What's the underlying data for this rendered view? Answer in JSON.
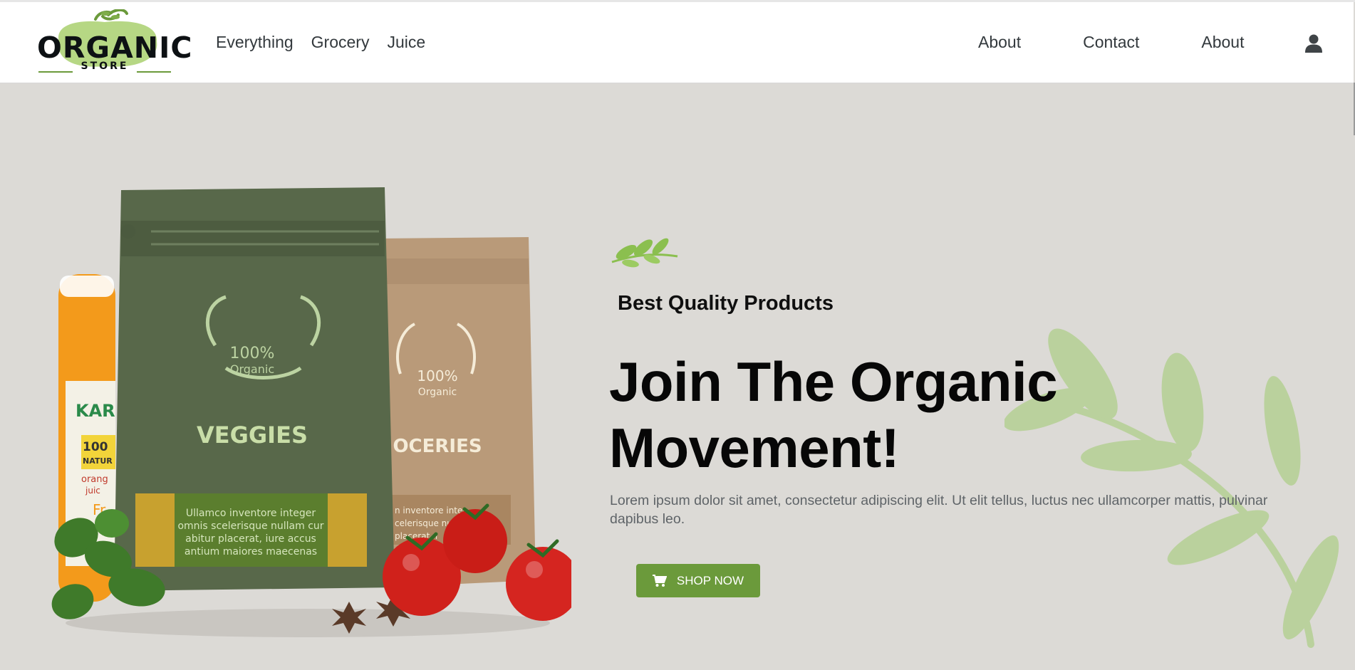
{
  "logo": {
    "word": "ORGANIC",
    "sub": "STORE"
  },
  "nav": {
    "left": [
      "Everything",
      "Grocery",
      "Juice"
    ],
    "right": [
      "About",
      "Contact",
      "About"
    ]
  },
  "hero": {
    "eyebrow": "Best Quality Products",
    "headline_line1": "Join The Organic",
    "headline_line2": "Movement!",
    "body": "Lorem ipsum dolor sit amet, consectetur adipiscing elit. Ut elit tellus, luctus nec ullamcorper mattis, pulvinar dapibus leo.",
    "cta_label": "SHOP NOW"
  },
  "products": {
    "bag1_badge_top": "100%",
    "bag1_badge_bottom": "Organic",
    "bag1_name": "VEGGIES",
    "bag1_label_lines": [
      "Ullamco inventore integer",
      "omnis scelerisque nullam cur",
      "abitur placerat, iure accus",
      "antium maiores maecenas"
    ],
    "bag2_badge_top": "100%",
    "bag2_badge_bottom": "Organic",
    "bag2_name": "OCERIES",
    "bag2_label_lines": [
      "n inventore inter",
      "celerisque null",
      "placerat, i"
    ],
    "jar_lines": [
      "KAR",
      "100",
      "NATUR",
      "orang",
      "juic",
      "Fr"
    ]
  },
  "icons": {
    "user": "user-icon",
    "cart": "cart-icon",
    "leaf": "leaf-sprig-icon"
  },
  "colors": {
    "brand_green": "#6b9a3b",
    "hero_bg": "#dcdad6",
    "bag_green": "#58684a",
    "bag_kraft": "#b99a79"
  }
}
